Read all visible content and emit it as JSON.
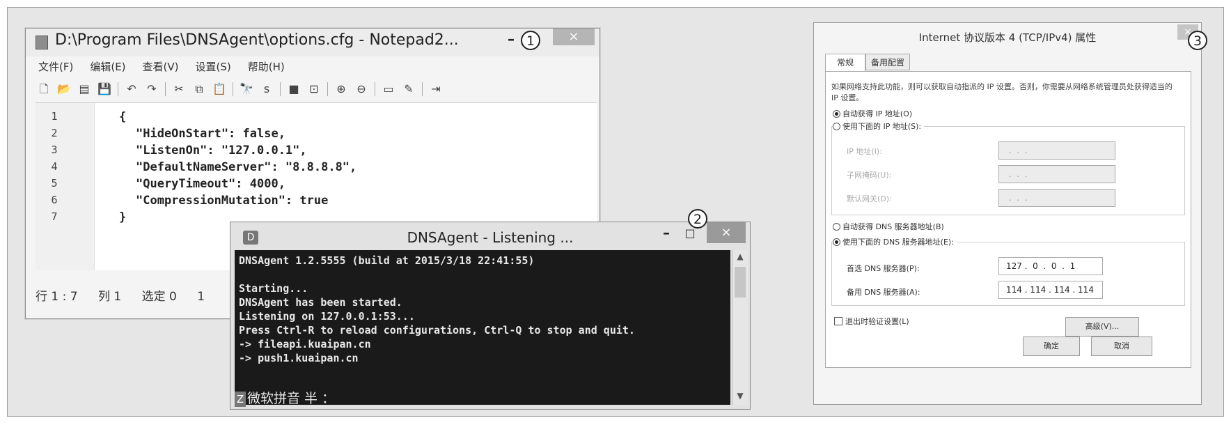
{
  "notepad": {
    "title": "D:\\Program Files\\DNSAgent\\options.cfg - Notepad2...",
    "badge": "1",
    "controls": {
      "minimize": "–",
      "maximize": "□",
      "close": "×"
    },
    "menu": [
      "文件(F)",
      "编辑(E)",
      "查看(V)",
      "设置(S)",
      "帮助(H)"
    ],
    "toolbar_icons": [
      "new-file-icon",
      "open-folder-icon",
      "browse-icon",
      "save-icon",
      "|",
      "undo-icon",
      "redo-icon",
      "|",
      "cut-icon",
      "copy-icon",
      "paste-icon",
      "|",
      "find-icon",
      "replace-icon",
      "|",
      "word-wrap-icon",
      "show-whitespace-icon",
      "|",
      "zoom-in-icon",
      "zoom-out-icon",
      "|",
      "scheme-icon",
      "customize-icon",
      "|",
      "exit-icon"
    ],
    "toolbar_glyphs": [
      "🗋",
      "📂",
      "▤",
      "💾",
      "|",
      "↶",
      "↷",
      "|",
      "✂",
      "⧉",
      "📋",
      "|",
      "🔭",
      "ꜱ",
      "|",
      "■",
      "⊡",
      "|",
      "⊕",
      "⊖",
      "|",
      "▭",
      "✎",
      "|",
      "⇥"
    ],
    "lines": [
      {
        "num": "1",
        "text": "{"
      },
      {
        "num": "2",
        "text": "\"HideOnStart\": false,"
      },
      {
        "num": "3",
        "text": "\"ListenOn\": \"127.0.0.1\","
      },
      {
        "num": "4",
        "text": "\"DefaultNameServer\": \"8.8.8.8\","
      },
      {
        "num": "5",
        "text": "\"QueryTimeout\": 4000,"
      },
      {
        "num": "6",
        "text": "\"CompressionMutation\": true"
      },
      {
        "num": "7",
        "text": "}"
      }
    ],
    "status": {
      "position": "行 1 : 7",
      "column": "列 1",
      "selection": "选定 0",
      "extra": "1"
    }
  },
  "console": {
    "title": "DNSAgent - Listening ...",
    "badge": "2",
    "icon_letter": "D",
    "controls": {
      "minimize": "–",
      "maximize": "□",
      "close": "×"
    },
    "lines": [
      "DNSAgent 1.2.5555 (build at 2015/3/18 22:41:55)",
      "",
      "Starting...",
      "DNSAgent has been started.",
      "Listening on 127.0.0.1:53...",
      "Press Ctrl-R to reload configurations, Ctrl-Q to stop and quit.",
      "-> fileapi.kuaipan.cn",
      "-> push1.kuaipan.cn"
    ],
    "ime": {
      "icon": "Z",
      "text": "微软拼音 半 ："
    },
    "scroll": {
      "up": "▲",
      "down": "▼"
    }
  },
  "dialog": {
    "title": "Internet 协议版本 4 (TCP/IPv4) 属性",
    "badge": "3",
    "close": "×",
    "tabs": [
      "常规",
      "备用配置"
    ],
    "description": "如果网络支持此功能，则可以获取自动指派的 IP 设置。否则，你需要从网络系统管理员处获得适当的 IP 设置。",
    "auto_ip": "自动获得 IP 地址(O)",
    "manual_ip": "使用下面的 IP 地址(S):",
    "ip_label": "IP 地址(I):",
    "mask_label": "子网掩码(U):",
    "gateway_label": "默认网关(D):",
    "empty_ip": " .  .  . ",
    "auto_dns": "自动获得 DNS 服务器地址(B)",
    "manual_dns": "使用下面的 DNS 服务器地址(E):",
    "preferred_dns_label": "首选 DNS 服务器(P):",
    "preferred_dns": "127 .  0  .  0  .  1",
    "alternate_dns_label": "备用 DNS 服务器(A):",
    "alternate_dns": "114 . 114 . 114 . 114",
    "validate_on_exit": "退出时验证设置(L)",
    "advanced": "高级(V)...",
    "ok": "确定",
    "cancel": "取消"
  }
}
